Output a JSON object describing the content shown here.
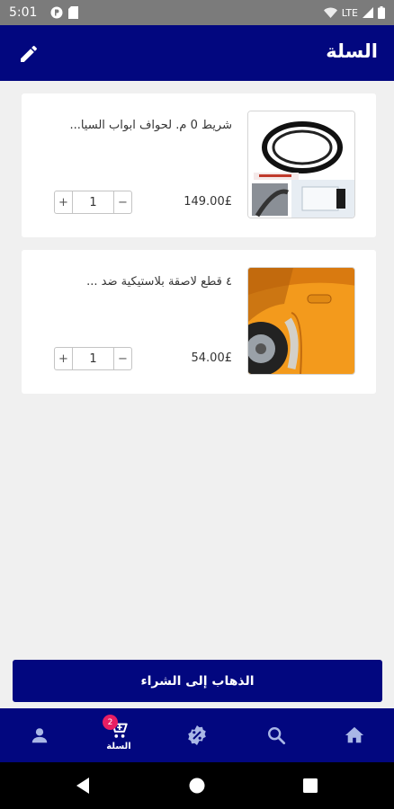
{
  "status_bar": {
    "time": "5:01",
    "network": "LTE"
  },
  "header": {
    "title": "السلة"
  },
  "cart": {
    "items": [
      {
        "title": "شريط 0 م. لحواف ابواب السيا...",
        "price": "149.00£",
        "quantity": "1",
        "plus": "+",
        "minus": "−"
      },
      {
        "title": "٤ قطع لاصقة بلاستيكية ضد ...",
        "price": "54.00£",
        "quantity": "1",
        "plus": "+",
        "minus": "−"
      }
    ]
  },
  "checkout": {
    "label": "الذهاب إلى الشراء"
  },
  "bottom_nav": {
    "cart_label": "السلة",
    "cart_badge": "2",
    "icons": [
      "profile-icon",
      "cart-icon",
      "offers-icon",
      "search-icon",
      "home-icon"
    ]
  },
  "colors": {
    "primary": "#02077f",
    "badge": "#e91e63",
    "background": "#f0f0f0"
  }
}
